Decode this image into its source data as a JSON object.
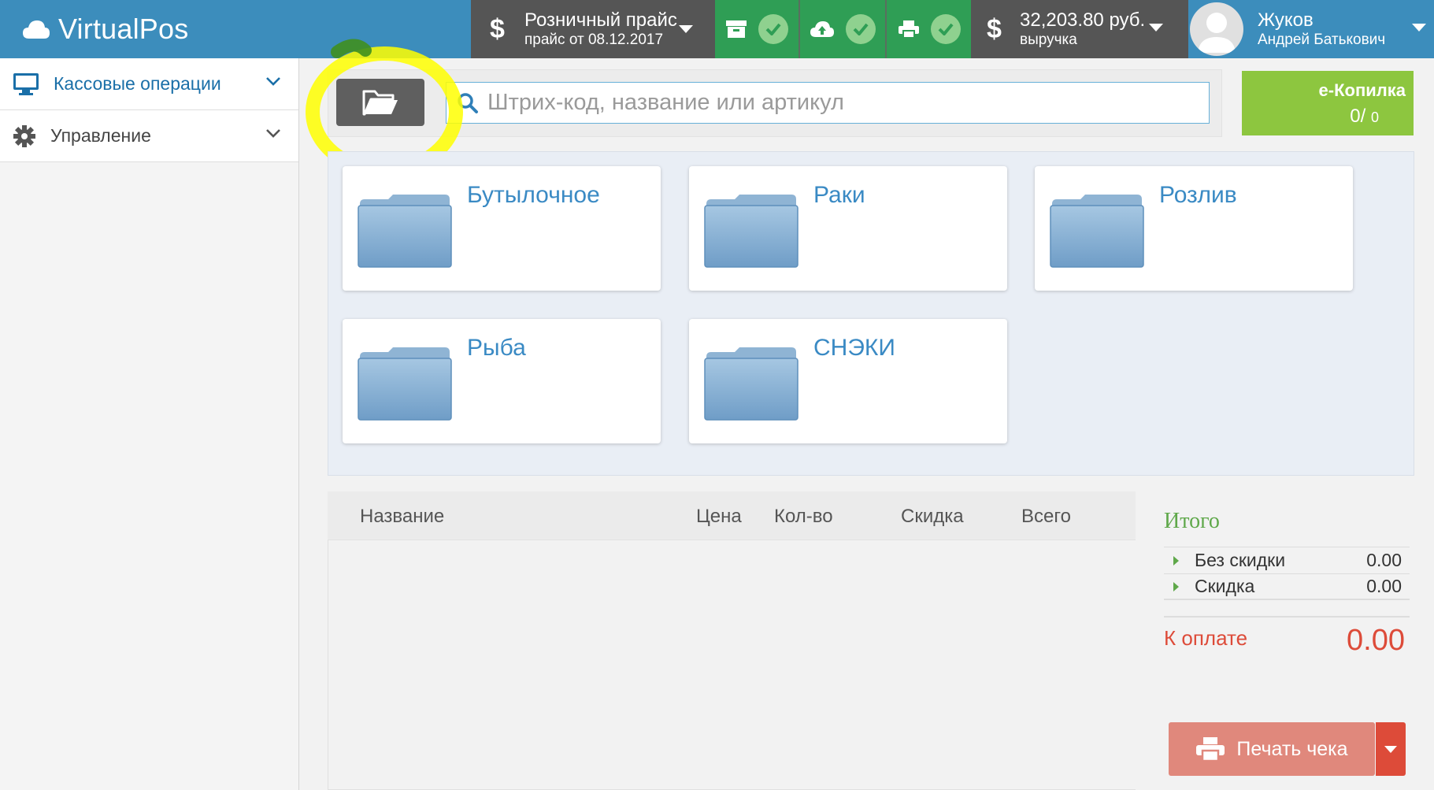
{
  "app": {
    "name": "VirtualPos"
  },
  "topbar": {
    "price": {
      "title": "Розничный прайс",
      "subtitle": "прайс от 08.12.2017"
    },
    "revenue": {
      "amount": "32,203.80 руб.",
      "label": "выручка"
    },
    "user": {
      "last_name": "Жуков",
      "full_name": "Андрей Батькович"
    }
  },
  "sidebar": {
    "items": [
      {
        "label": "Кассовые операции",
        "icon": "monitor-icon"
      },
      {
        "label": "Управление",
        "icon": "gear-icon"
      }
    ]
  },
  "search": {
    "placeholder": "Штрих-код, название или артикул",
    "value": ""
  },
  "ekopilka": {
    "title": "е-Копилка",
    "value": "0/",
    "max": "0"
  },
  "categories": [
    {
      "name": "Бутылочное"
    },
    {
      "name": "Раки"
    },
    {
      "name": "Розлив"
    },
    {
      "name": "Рыба"
    },
    {
      "name": "СНЭКИ"
    }
  ],
  "order_table": {
    "columns": [
      "Название",
      "Цена",
      "Кол-во",
      "Скидка",
      "Всего"
    ],
    "rows": []
  },
  "totals": {
    "title": "Итого",
    "rows": [
      {
        "label": "Без скидки",
        "value": "0.00"
      },
      {
        "label": "Скидка",
        "value": "0.00"
      }
    ],
    "pay_label": "К оплате",
    "pay_amount": "0.00"
  },
  "print_button": {
    "label": "Печать чека"
  },
  "colors": {
    "brand": "#3c8dbc",
    "dark_bar": "#555555",
    "status_green": "#2f9e55",
    "ekopilka": "#8dc63f",
    "accent_red": "#dd4b39",
    "highlight_marker": "#ffff00"
  }
}
